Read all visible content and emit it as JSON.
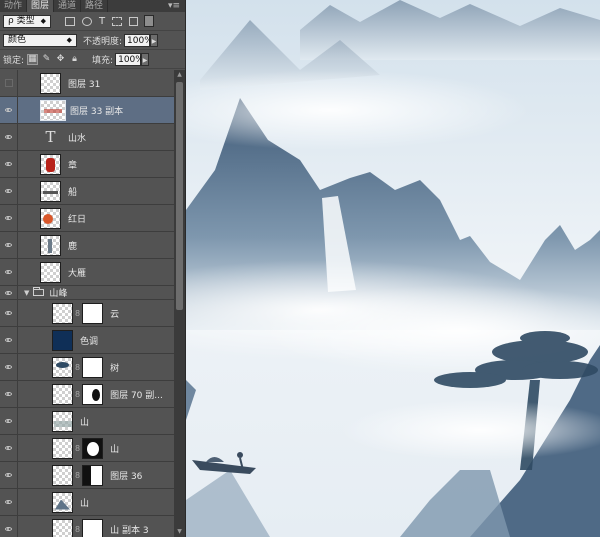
{
  "panel": {
    "tabs": [
      {
        "label": "动作",
        "active": false
      },
      {
        "label": "图层",
        "active": true
      },
      {
        "label": "通道",
        "active": false
      },
      {
        "label": "路径",
        "active": false
      }
    ],
    "filter": {
      "kind_label": "ρ 类型"
    },
    "blend": {
      "mode": "颜色",
      "opacity_label": "不透明度:",
      "opacity_value": "100%"
    },
    "lock": {
      "label": "锁定:",
      "fill_label": "填充:",
      "fill_value": "100%"
    }
  },
  "layers": [
    {
      "name": "图层 31",
      "visible": false
    },
    {
      "name": "图层 33 副本",
      "visible": true,
      "selected": true
    },
    {
      "name": "山水",
      "visible": true,
      "type": "text"
    },
    {
      "name": "章",
      "visible": true
    },
    {
      "name": "船",
      "visible": true
    },
    {
      "name": "红日",
      "visible": true
    },
    {
      "name": "鹿",
      "visible": true
    },
    {
      "name": "大雁",
      "visible": true
    },
    {
      "name": "山峰",
      "visible": true,
      "type": "group"
    },
    {
      "name": "云",
      "visible": true
    },
    {
      "name": "色调",
      "visible": true
    },
    {
      "name": "树",
      "visible": true
    },
    {
      "name": "图层 70 副...",
      "visible": true
    },
    {
      "name": "山",
      "visible": true
    },
    {
      "name": "山",
      "visible": true
    },
    {
      "name": "图层 36",
      "visible": true
    },
    {
      "name": "山",
      "visible": true
    },
    {
      "name": "山 副本 3",
      "visible": true
    }
  ],
  "colors": {
    "panel_bg": "#535353",
    "selected_row": "#5e6e84",
    "tone_swatch": "#0f2f57"
  }
}
